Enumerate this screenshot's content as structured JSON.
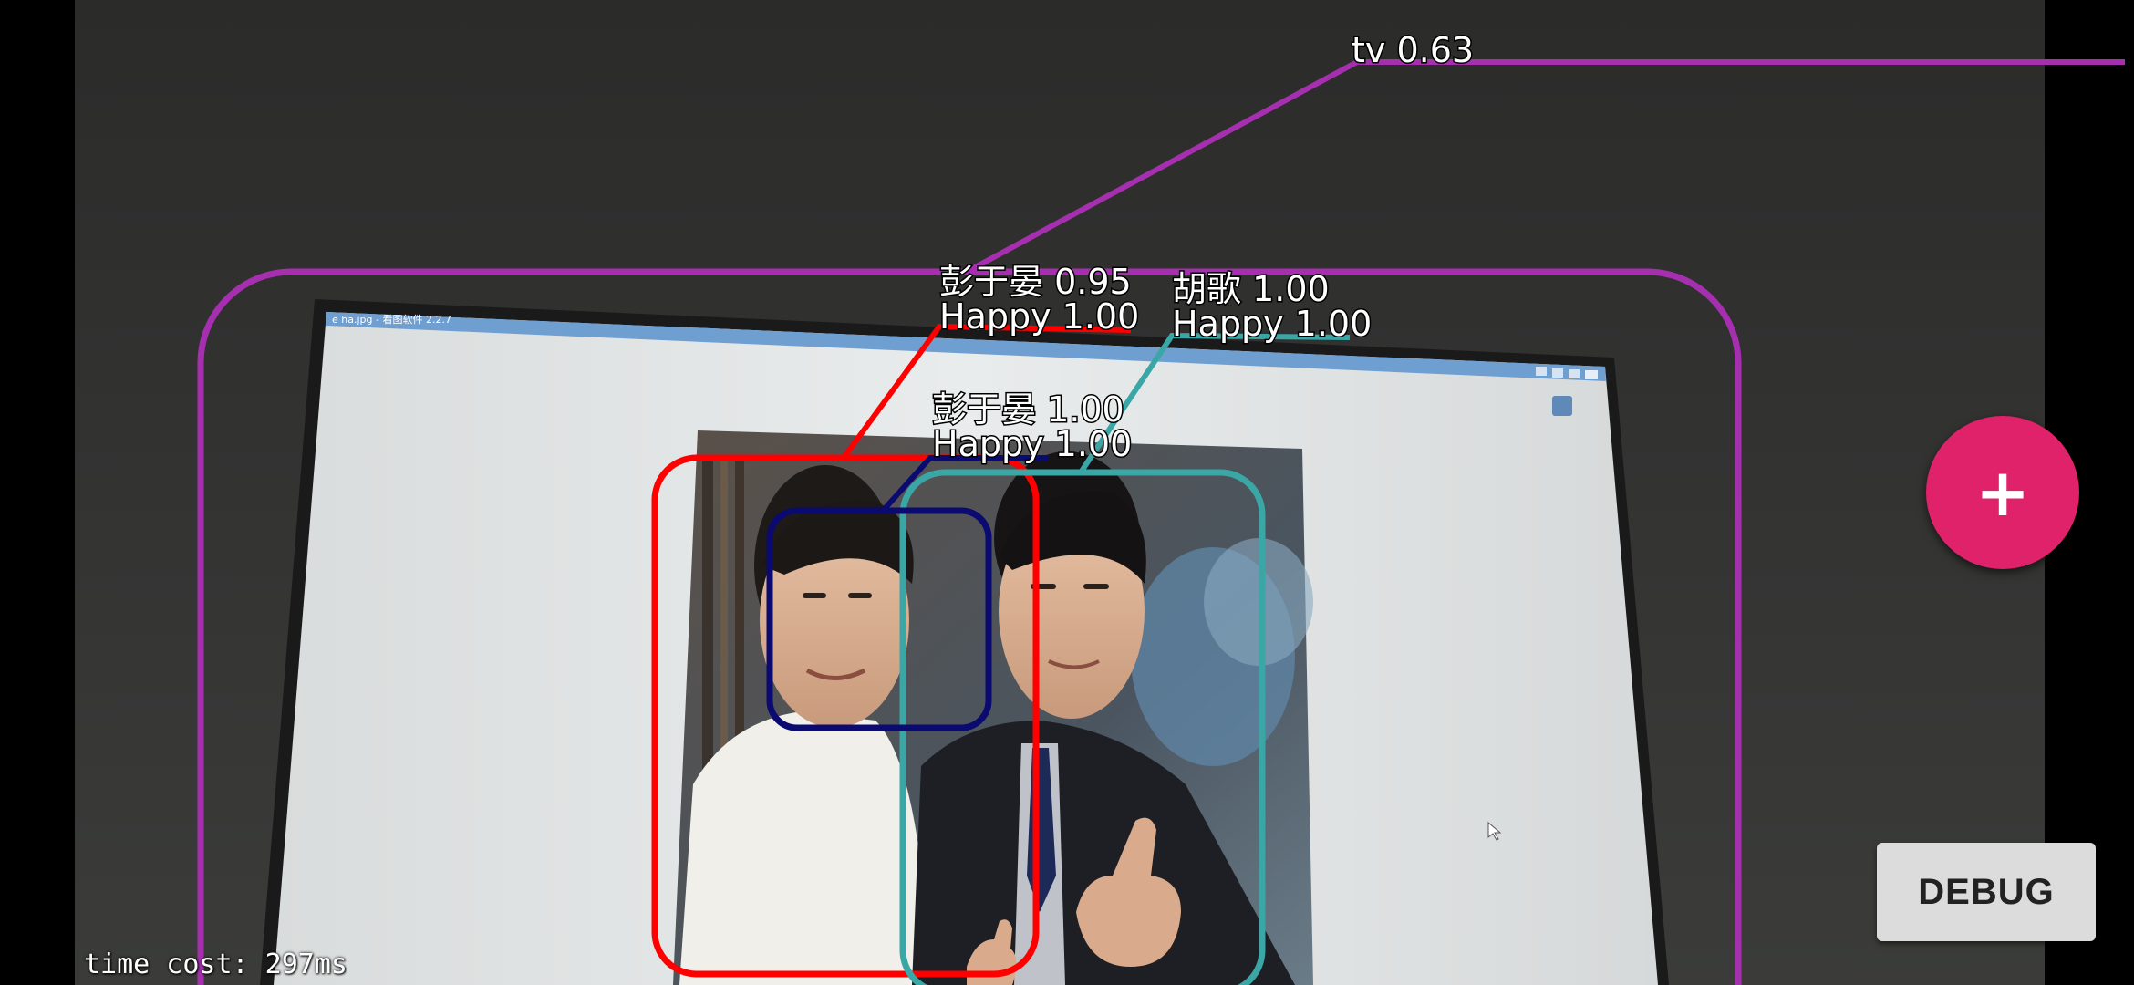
{
  "camera_preview": {
    "monitor_titlebar": "e ha.jpg - 看图软件 2.2.7"
  },
  "detections": [
    {
      "label": "tv 0.63",
      "color": "#a62fb0"
    },
    {
      "label_lines": [
        "彭于晏 0.95",
        "Happy 1.00"
      ],
      "color": "#ff0000"
    },
    {
      "label_lines": [
        "胡歌 1.00",
        "Happy 1.00"
      ],
      "color": "#3aa6a6"
    },
    {
      "label_lines": [
        "彭于晏 1.00",
        "Happy 1.00"
      ],
      "color": "#0a0a70"
    }
  ],
  "fab": {
    "icon": "plus-icon",
    "glyph": "+",
    "color": "#e0226a"
  },
  "debug_button": {
    "label": "DEBUG"
  },
  "status": {
    "time_cost": "time cost: 297ms"
  }
}
